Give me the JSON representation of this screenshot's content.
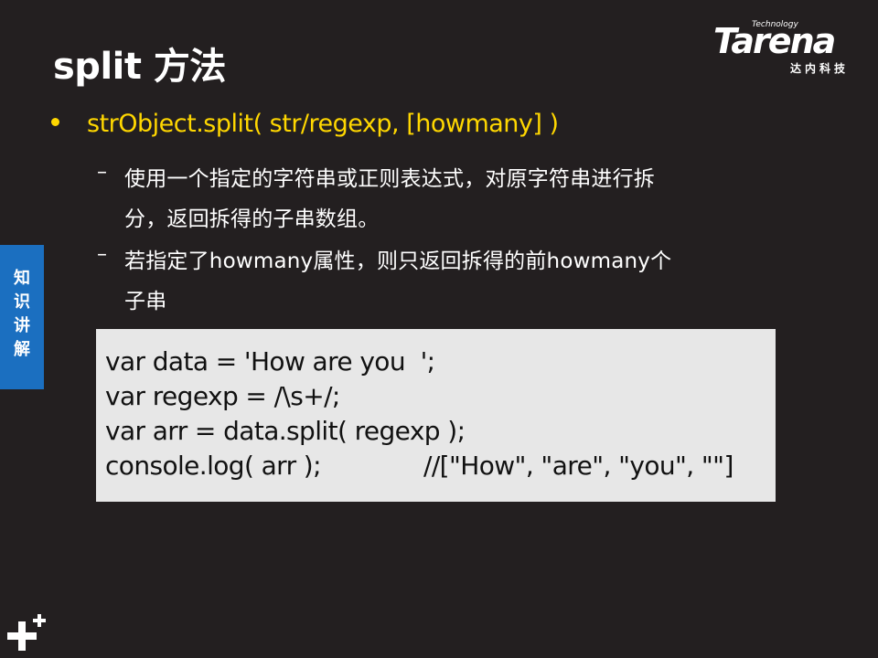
{
  "slide": {
    "title": "split 方法",
    "logo": {
      "wordmark": "Tarena",
      "tagline": "Technology",
      "subtitle": "达内科技"
    },
    "side_tab": "知识讲解",
    "bullet": "strObject.split( str/regexp, [howmany] )",
    "sub_dash": "–",
    "sub_items": [
      {
        "line1": "使用一个指定的字符串或正则表达式，对原字符串进行拆",
        "line2": "分，返回拆得的子串数组。"
      },
      {
        "line1": "若指定了howmany属性，则只返回拆得的前howmany个",
        "line2": "子串"
      }
    ],
    "code": {
      "line1": "var data = 'How are you  ';",
      "line2": "var regexp = /\\s+/;",
      "line3": "var arr = data.split( regexp );",
      "line4": "console.log( arr );",
      "line4_comment": "//[\"How\", \"are\", \"you\", \"\"]"
    },
    "colors": {
      "background": "#231f20",
      "bullet_text": "#ffd700",
      "side_tab": "#1b6fc0",
      "code_background": "#e7e7e7"
    }
  }
}
